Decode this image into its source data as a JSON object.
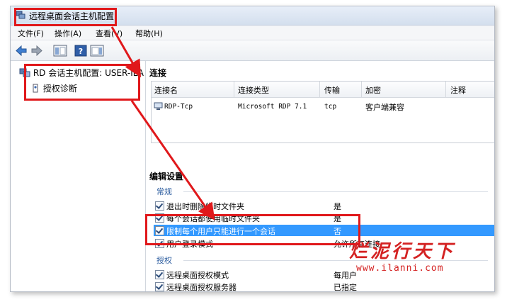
{
  "window": {
    "title": "远程桌面会话主机配置"
  },
  "menu": [
    "文件(F)",
    "操作(A)",
    "查看(V)",
    "帮助(H)"
  ],
  "tree": {
    "root": "RD 会话主机配置: USER-ILA",
    "child": "授权诊断"
  },
  "connections": {
    "header": "连接",
    "columns": [
      "连接名",
      "连接类型",
      "传输",
      "加密",
      "注释"
    ],
    "rows": [
      {
        "name": "RDP-Tcp",
        "type": "Microsoft RDP 7.1",
        "transport": "tcp",
        "encryption": "客户端兼容",
        "comment": ""
      }
    ]
  },
  "edit": {
    "header": "编辑设置",
    "groups": [
      {
        "title": "常规",
        "items": [
          {
            "name": "退出时删除临时文件夹",
            "value": "是"
          },
          {
            "name": "每个会话都使用临时文件夹",
            "value": "是"
          },
          {
            "name": "限制每个用户只能进行一个会话",
            "value": "否"
          },
          {
            "name": "用户登录模式",
            "value": "允许所有连接"
          }
        ]
      },
      {
        "title": "授权",
        "items": [
          {
            "name": "远程桌面授权模式",
            "value": "每用户"
          },
          {
            "name": "远程桌面授权服务器",
            "value": "已指定"
          }
        ]
      }
    ]
  },
  "watermark": {
    "text": "烂泥行天下",
    "url": "www.ilanni.com"
  },
  "colors": {
    "highlight": "#e0181b",
    "selection": "#3399ff"
  }
}
